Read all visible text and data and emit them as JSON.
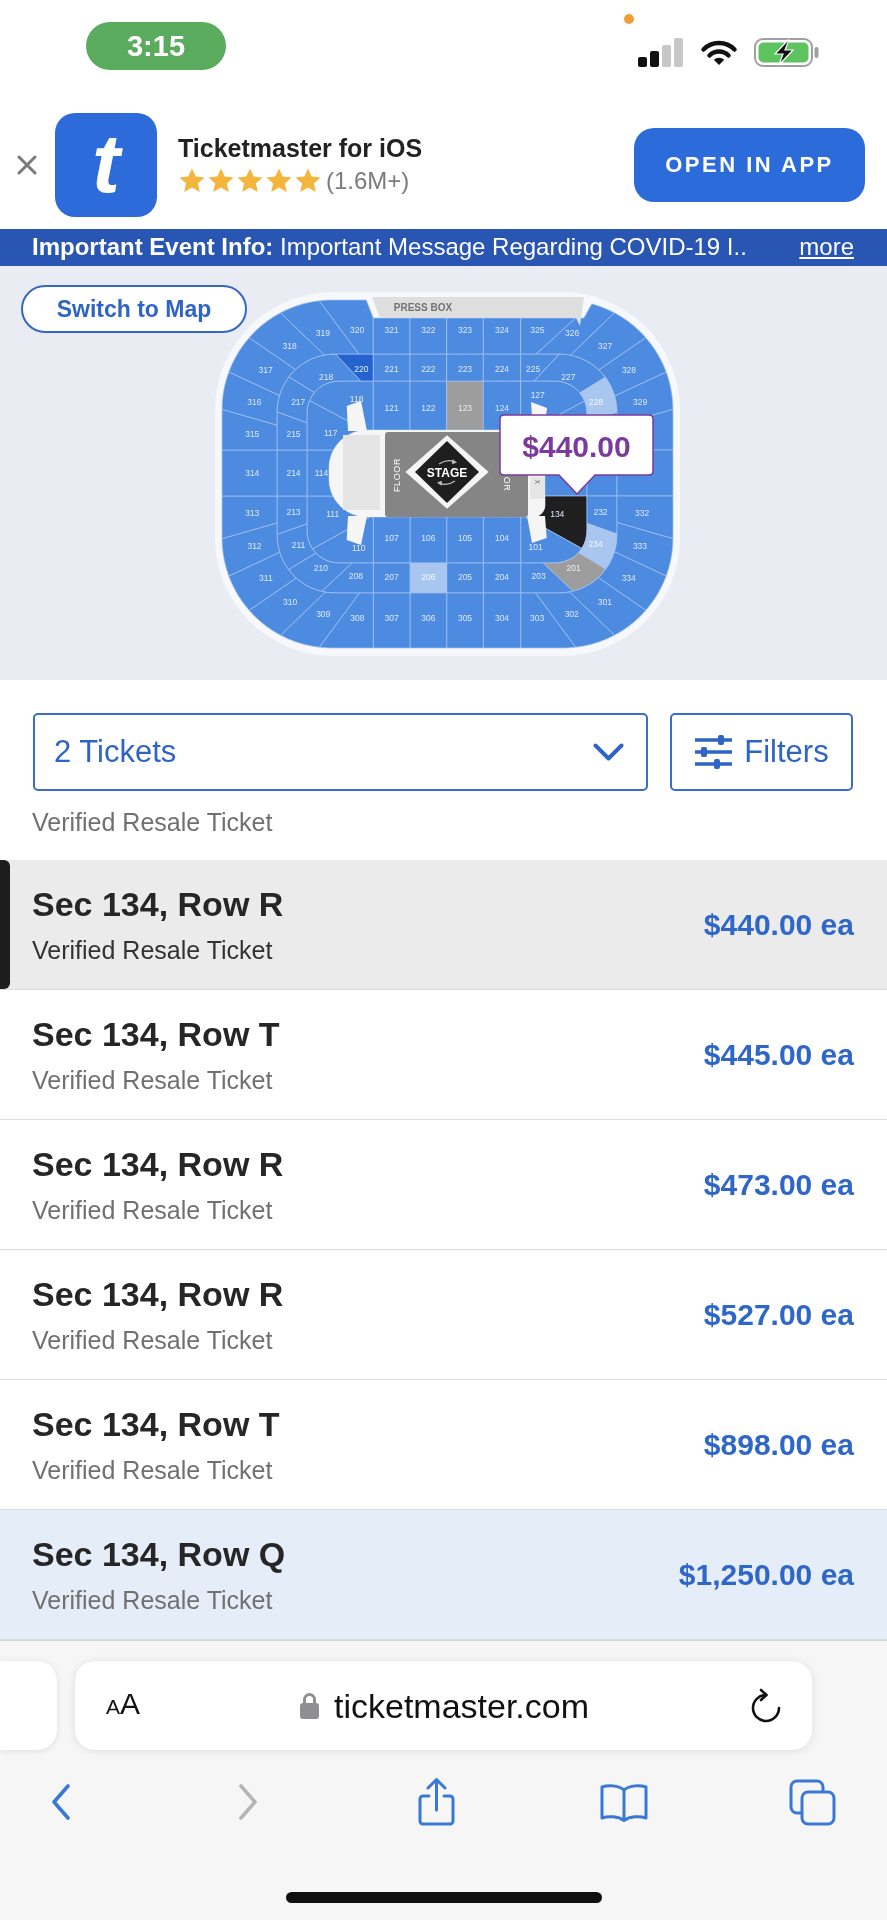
{
  "status_bar": {
    "time": "3:15"
  },
  "app_banner": {
    "logo_text": "t",
    "title": "Ticketmaster for iOS",
    "stars": 5,
    "rating_count": "(1.6M+)",
    "button": "OPEN IN APP"
  },
  "info_bar": {
    "text": "**Important Event Info:** Important Message Regarding COVID-19 I..",
    "link": "more"
  },
  "map": {
    "switch_button": "Switch to Map",
    "press_box": "PRESS BOX",
    "floor_labels": [
      "FLOOR",
      "OR"
    ],
    "marker_label": "X",
    "stage": "STAGE",
    "levels": [
      {
        "top": [
          {
            "label": "118",
            "kind": "available",
            "selected": false
          },
          {
            "label": "121",
            "kind": "available",
            "selected": false
          },
          {
            "label": "122",
            "kind": "available",
            "selected": false
          },
          {
            "label": "123",
            "kind": "unavailable",
            "selected": false
          },
          {
            "label": "124",
            "kind": "available",
            "selected": false
          },
          {
            "label": "127",
            "kind": "available",
            "selected": false
          }
        ],
        "left": [
          {
            "label": "117",
            "kind": "available",
            "selected": false
          },
          {
            "label": "114",
            "kind": "available",
            "selected": false
          },
          {
            "label": "111",
            "kind": "available",
            "selected": false
          }
        ],
        "right": [
          {
            "kind": "available",
            "selected": false
          },
          {
            "kind": "available",
            "selected": false
          },
          {
            "label": "134",
            "kind": "available",
            "selected": true
          }
        ],
        "bottom": [
          {
            "label": "110",
            "kind": "available",
            "selected": false
          },
          {
            "label": "107",
            "kind": "available",
            "selected": false
          },
          {
            "label": "106",
            "kind": "available",
            "selected": false
          },
          {
            "label": "105",
            "kind": "available",
            "selected": false
          },
          {
            "label": "104",
            "kind": "available",
            "selected": false
          },
          {
            "label": "101",
            "kind": "available",
            "selected": false
          }
        ]
      },
      {
        "top": [
          {
            "label": "217",
            "kind": "available",
            "selected": false
          },
          {
            "label": "218",
            "kind": "available",
            "selected": false
          },
          {
            "label": "220",
            "kind": "highlighted",
            "selected": false
          },
          {
            "label": "221",
            "kind": "available",
            "selected": false
          },
          {
            "label": "222",
            "kind": "available",
            "selected": false
          },
          {
            "label": "223",
            "kind": "available",
            "selected": false
          },
          {
            "label": "224",
            "kind": "available",
            "selected": false
          },
          {
            "label": "225",
            "kind": "available",
            "selected": false
          },
          {
            "label": "227",
            "kind": "available",
            "selected": false
          },
          {
            "label": "228",
            "kind": "faded",
            "selected": false
          }
        ],
        "left": [
          {
            "label": "215",
            "kind": "available",
            "selected": false
          },
          {
            "label": "214",
            "kind": "available",
            "selected": false
          },
          {
            "label": "213",
            "kind": "available",
            "selected": false
          }
        ],
        "right": [
          {
            "kind": "available",
            "selected": false
          },
          {
            "kind": "available",
            "selected": false
          },
          {
            "label": "232",
            "kind": "available",
            "selected": false
          }
        ],
        "bottom": [
          {
            "label": "211",
            "kind": "available",
            "selected": false
          },
          {
            "label": "210",
            "kind": "available",
            "selected": false
          },
          {
            "label": "208",
            "kind": "available",
            "selected": false
          },
          {
            "label": "207",
            "kind": "available",
            "selected": false
          },
          {
            "label": "206",
            "kind": "faded",
            "selected": false
          },
          {
            "label": "205",
            "kind": "available",
            "selected": false
          },
          {
            "label": "204",
            "kind": "available",
            "selected": false
          },
          {
            "label": "203",
            "kind": "available",
            "selected": false
          },
          {
            "label": "201",
            "kind": "unavailable",
            "selected": false
          },
          {
            "label": "234",
            "kind": "faded",
            "selected": false
          }
        ]
      },
      {
        "top": [
          {
            "label": "317",
            "kind": "available",
            "selected": false
          },
          {
            "label": "318",
            "kind": "available",
            "selected": false
          },
          {
            "label": "319",
            "kind": "available",
            "selected": false
          },
          {
            "label": "320",
            "kind": "available",
            "selected": false
          },
          {
            "label": "321",
            "kind": "available",
            "selected": false
          },
          {
            "label": "322",
            "kind": "available",
            "selected": false
          },
          {
            "label": "323",
            "kind": "available",
            "selected": false
          },
          {
            "label": "324",
            "kind": "available",
            "selected": false
          },
          {
            "label": "325",
            "kind": "available",
            "selected": false
          },
          {
            "label": "326",
            "kind": "available",
            "selected": false
          },
          {
            "label": "327",
            "kind": "available",
            "selected": false
          },
          {
            "label": "328",
            "kind": "available",
            "selected": false
          }
        ],
        "left": [
          {
            "label": "316",
            "kind": "available",
            "selected": false
          },
          {
            "label": "315",
            "kind": "available",
            "selected": false
          },
          {
            "label": "314",
            "kind": "available",
            "selected": false
          },
          {
            "label": "313",
            "kind": "available",
            "selected": false
          },
          {
            "label": "312",
            "kind": "available",
            "selected": false
          }
        ],
        "right": [
          {
            "label": "329",
            "kind": "available",
            "selected": false
          },
          {
            "kind": "available",
            "selected": false
          },
          {
            "kind": "available",
            "selected": false
          },
          {
            "label": "332",
            "kind": "available",
            "selected": false
          },
          {
            "label": "333",
            "kind": "available",
            "selected": false
          }
        ],
        "bottom": [
          {
            "label": "311",
            "kind": "available",
            "selected": false
          },
          {
            "label": "310",
            "kind": "available",
            "selected": false
          },
          {
            "label": "309",
            "kind": "available",
            "selected": false
          },
          {
            "label": "308",
            "kind": "available",
            "selected": false
          },
          {
            "label": "307",
            "kind": "available",
            "selected": false
          },
          {
            "label": "306",
            "kind": "available",
            "selected": false
          },
          {
            "label": "305",
            "kind": "available",
            "selected": false
          },
          {
            "label": "304",
            "kind": "available",
            "selected": false
          },
          {
            "label": "303",
            "kind": "available",
            "selected": false
          },
          {
            "label": "302",
            "kind": "available",
            "selected": false
          },
          {
            "label": "301",
            "kind": "available",
            "selected": false
          },
          {
            "label": "334",
            "kind": "available",
            "selected": false
          }
        ]
      }
    ],
    "tooltip": "$440.00"
  },
  "controls": {
    "quantity": "2 Tickets",
    "filters": "Filters"
  },
  "listings": {
    "partial_subtitle": "Verified Resale Ticket",
    "rows": [
      {
        "title": "Sec 134, Row R",
        "subtitle": "Verified Resale Ticket",
        "price": "$440.00 ea",
        "selected": true,
        "highlighted": false
      },
      {
        "title": "Sec 134, Row T",
        "subtitle": "Verified Resale Ticket",
        "price": "$445.00 ea",
        "selected": false,
        "highlighted": false
      },
      {
        "title": "Sec 134, Row R",
        "subtitle": "Verified Resale Ticket",
        "price": "$473.00 ea",
        "selected": false,
        "highlighted": false
      },
      {
        "title": "Sec 134, Row R",
        "subtitle": "Verified Resale Ticket",
        "price": "$527.00 ea",
        "selected": false,
        "highlighted": false
      },
      {
        "title": "Sec 134, Row T",
        "subtitle": "Verified Resale Ticket",
        "price": "$898.00 ea",
        "selected": false,
        "highlighted": false
      },
      {
        "title": "Sec 134, Row Q",
        "subtitle": "Verified Resale Ticket",
        "price": "$1,250.00 ea",
        "selected": false,
        "highlighted": true
      }
    ]
  },
  "browser": {
    "text_size_button": "AA",
    "url": "ticketmaster.com",
    "toolbar": [
      {
        "kind": "back",
        "disabled": false
      },
      {
        "kind": "forward",
        "disabled": true
      },
      {
        "kind": "share",
        "disabled": false
      },
      {
        "kind": "bookmarks",
        "disabled": false
      },
      {
        "kind": "tabs",
        "disabled": false
      }
    ]
  }
}
